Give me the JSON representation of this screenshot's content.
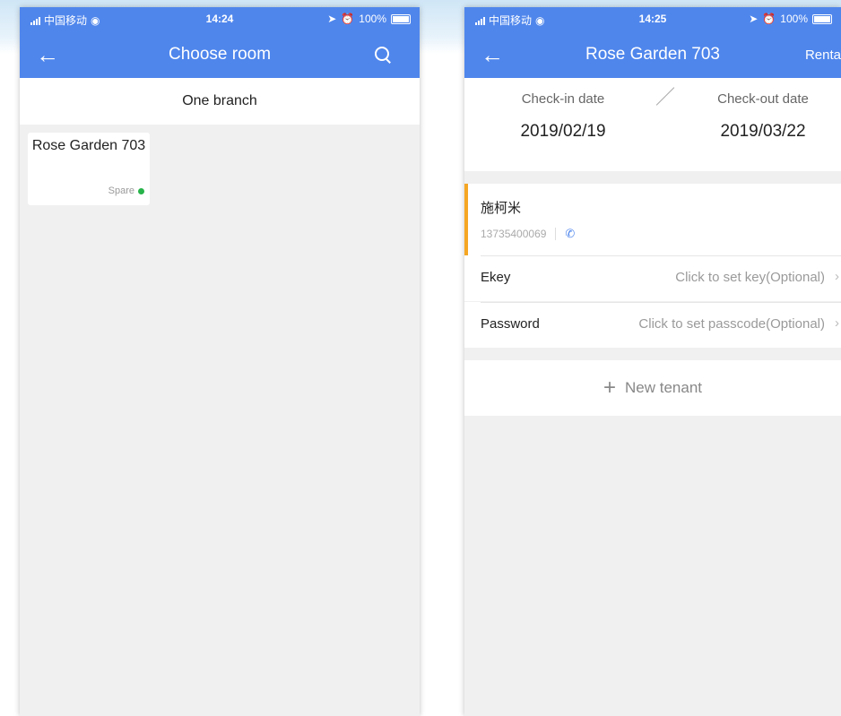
{
  "status_left": {
    "carrier": "中国移动",
    "time": "14:24",
    "battery": "100%"
  },
  "status_right": {
    "carrier": "中国移动",
    "time": "14:25",
    "battery": "100%"
  },
  "screen1": {
    "title": "Choose room",
    "branch": "One branch",
    "rooms": [
      {
        "name": "Rose Garden 703",
        "status": "Spare",
        "status_color": "#27b34a"
      }
    ]
  },
  "screen2": {
    "title": "Rose Garden 703",
    "right_action": "Renta",
    "checkin_label": "Check-in date",
    "checkin_value": "2019/02/19",
    "checkout_label": "Check-out date",
    "checkout_value": "2019/03/22",
    "tenant": {
      "name": "施柯米",
      "phone": "13735400069"
    },
    "ekey_label": "Ekey",
    "ekey_value": "Click to set key(Optional)",
    "password_label": "Password",
    "password_value": "Click to set passcode(Optional)",
    "new_tenant_label": "New tenant"
  },
  "colors": {
    "header": "#4f86ec",
    "accent_bar": "#f5a623",
    "background": "#f0f0f0"
  }
}
